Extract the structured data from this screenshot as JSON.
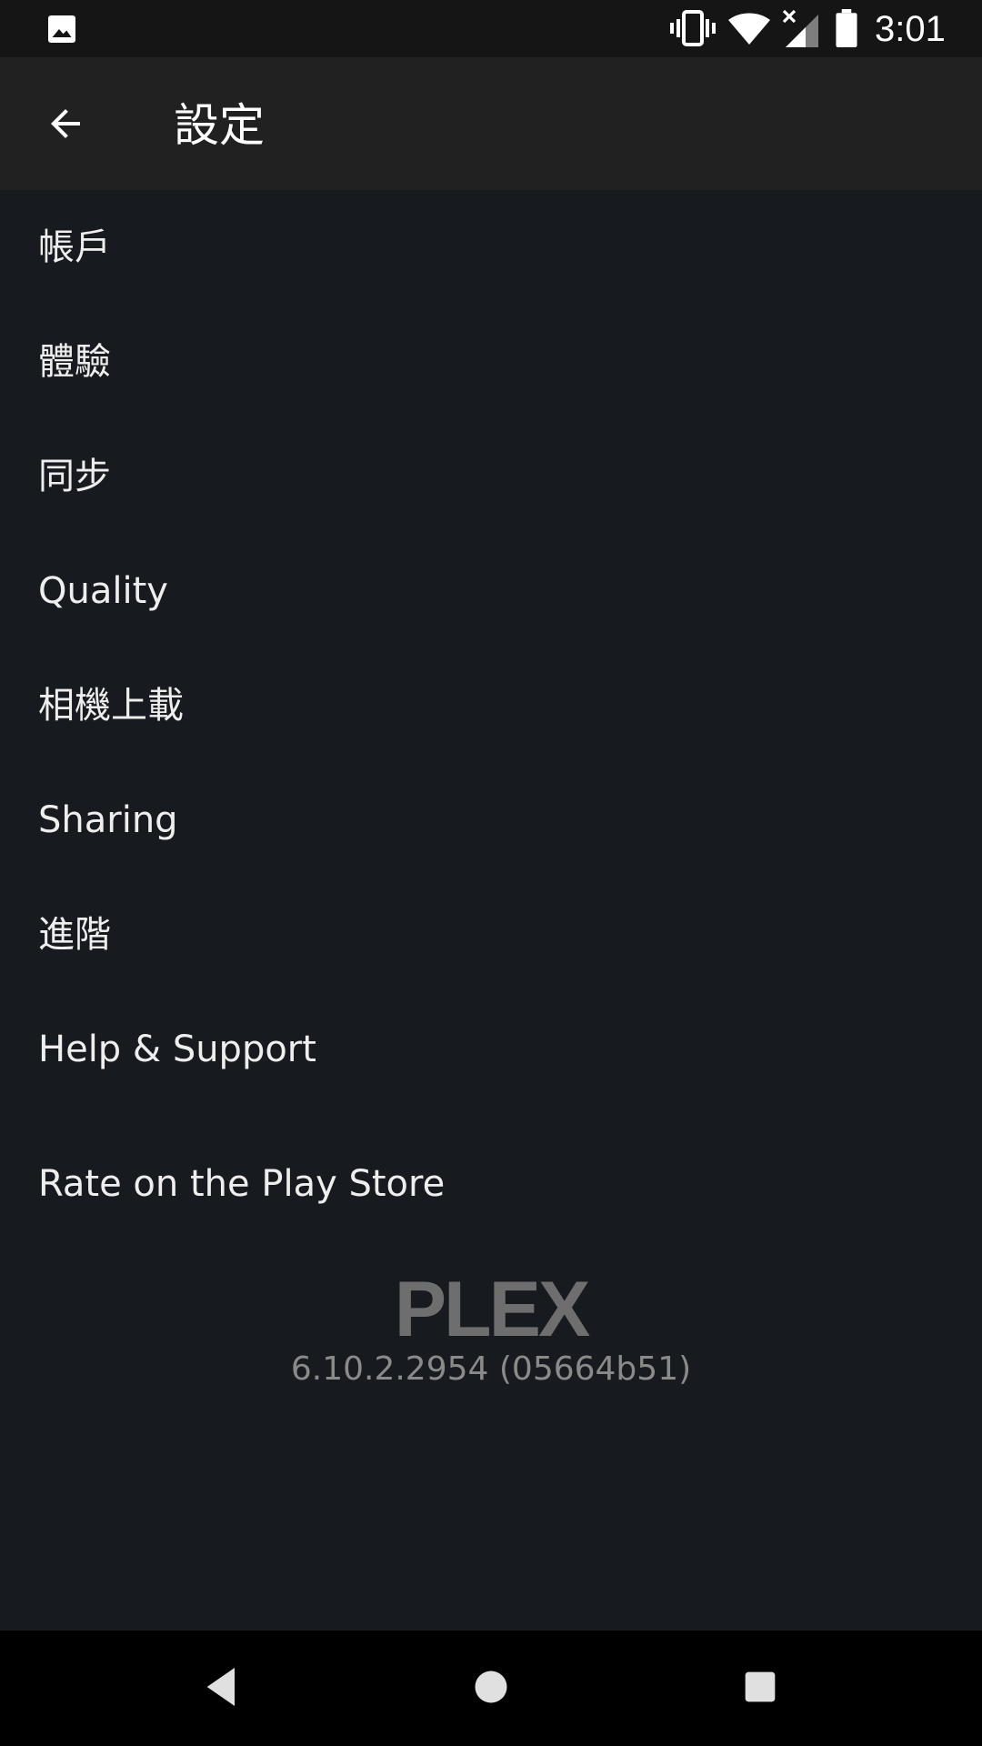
{
  "status_bar": {
    "time": "3:01",
    "icons": [
      "gallery-icon",
      "vibrate-icon",
      "wifi-icon",
      "signal-icon",
      "battery-icon"
    ]
  },
  "app_bar": {
    "title": "設定",
    "back_icon": "arrow-back-icon"
  },
  "settings": {
    "items": [
      {
        "label": "帳戶"
      },
      {
        "label": "體驗"
      },
      {
        "label": "同步"
      },
      {
        "label": "Quality"
      },
      {
        "label": "相機上載"
      },
      {
        "label": "Sharing"
      },
      {
        "label": "進階"
      },
      {
        "label": "Help & Support"
      },
      {
        "label": "Rate on the Play Store"
      }
    ]
  },
  "footer": {
    "logo_text": "PLEX",
    "version": "6.10.2.2954 (05664b51)"
  },
  "nav_bar": {
    "icons": [
      "nav-back-icon",
      "nav-home-icon",
      "nav-recents-icon"
    ]
  },
  "colors": {
    "background": "#171a1e",
    "app_bar": "#212121",
    "status_bar": "#151515",
    "text_primary": "#eeeeee",
    "text_secondary": "#8a8a8a"
  }
}
